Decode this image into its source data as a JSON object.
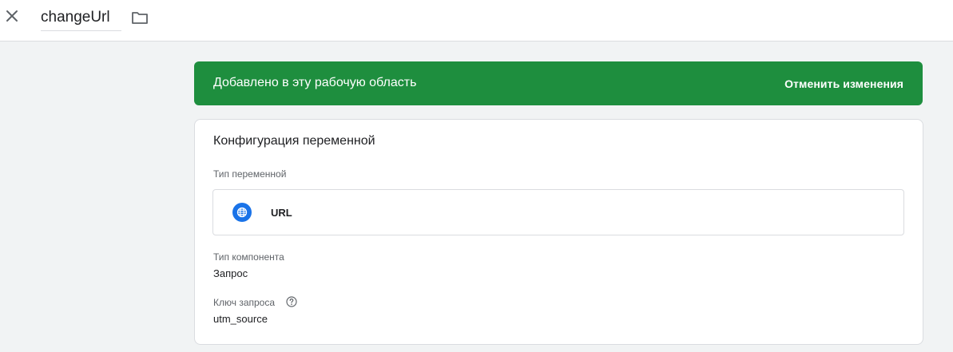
{
  "header": {
    "title": "changeUrl",
    "close_icon": "close-icon",
    "folder_icon": "folder-icon"
  },
  "banner": {
    "message": "Добавлено в эту рабочую область",
    "action": "Отменить изменения",
    "color": "#1e8e3e"
  },
  "config": {
    "title": "Конфигурация переменной",
    "variable_type_label": "Тип переменной",
    "variable_type_value": "URL",
    "variable_type_icon": "globe-icon",
    "component_type_label": "Тип компонента",
    "component_type_value": "Запрос",
    "query_key_label": "Ключ запроса",
    "query_key_help_icon": "help-icon",
    "query_key_value": "utm_source"
  },
  "colors": {
    "accent": "#1a73e8",
    "banner": "#1e8e3e",
    "background": "#f1f3f4"
  }
}
